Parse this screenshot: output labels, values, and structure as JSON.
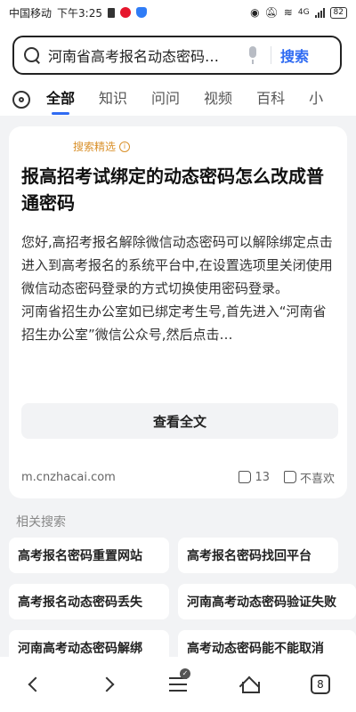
{
  "status_bar": {
    "carrier": "中国移动",
    "time": "下午3:25",
    "network": "4G",
    "battery": "82"
  },
  "search": {
    "query": "河南省高考报名动态密码…",
    "button_label": "搜索"
  },
  "tabs": [
    {
      "label": "全部",
      "active": true
    },
    {
      "label": "知识"
    },
    {
      "label": "问问"
    },
    {
      "label": "视频"
    },
    {
      "label": "百科"
    },
    {
      "label": "小"
    }
  ],
  "result": {
    "tag": "搜索精选",
    "title": "报高招考试绑定的动态密码怎么改成普通密码",
    "body_p1": "您好,高招考报名解除微信动态密码可以解除绑定点击进入到高考报名的系统平台中,在设置选项里关闭使用微信动态密码登录的方式切换使用密码登录。",
    "body_p2": "河南省招生办公室如已绑定考生号,首先进入“河南省招生办公室”微信公众号,然后点击…",
    "readmore_label": "查看全文",
    "source": "m.cnzhacai.com",
    "likes": "13",
    "dislike_label": "不喜欢"
  },
  "related": {
    "title": "相关搜索",
    "items": [
      "高考报名密码重置网站",
      "高考报名密码找回平台",
      "高考报名动态密码丢失",
      "河南高考动态密码验证失败",
      "河南高考动态密码解绑",
      "高考动态密码能不能取消"
    ]
  },
  "bottom_nav": {
    "tab_count": "8"
  }
}
